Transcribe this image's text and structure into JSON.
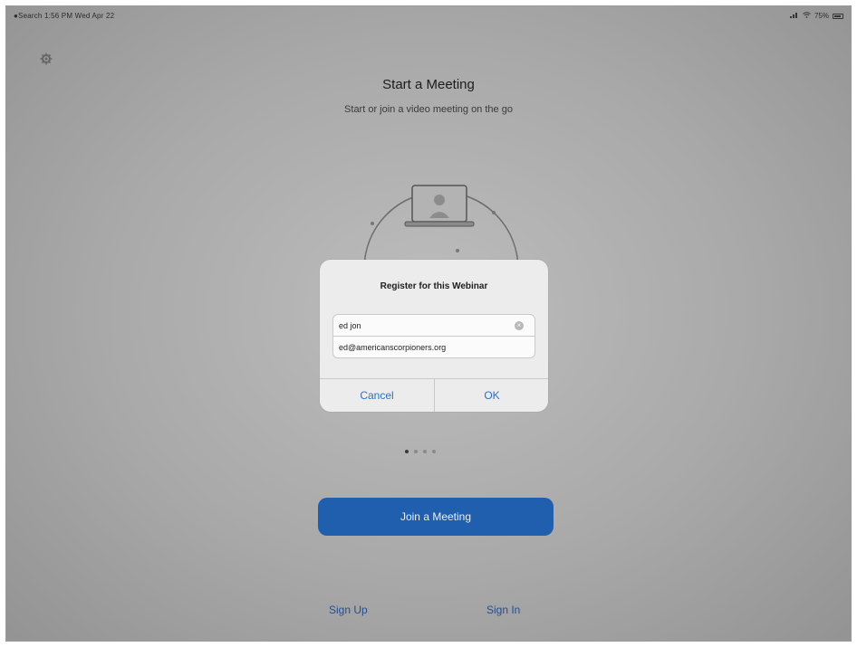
{
  "status_bar": {
    "left_text": "●Search 1:56 PM Wed Apr 22",
    "battery_text": "75%"
  },
  "header": {
    "title": "Start a Meeting",
    "subtitle": "Start or join a video meeting on the go"
  },
  "pagination": {
    "count": 4,
    "active": 1
  },
  "join_button_label": "Join a Meeting",
  "footer": {
    "signup_label": "Sign Up",
    "signin_label": "Sign In"
  },
  "dialog": {
    "title": "Register for this Webinar",
    "name_value": "ed jon",
    "email_value": "ed@americanscorpioners.org",
    "cancel_label": "Cancel",
    "ok_label": "OK"
  },
  "colors": {
    "accent": "#2e6fc8",
    "join_button": "#1f5fae"
  },
  "icons": {
    "settings": "gear-icon",
    "wifi": "wifi-icon",
    "battery": "battery-icon",
    "clear": "clear-text-icon"
  }
}
